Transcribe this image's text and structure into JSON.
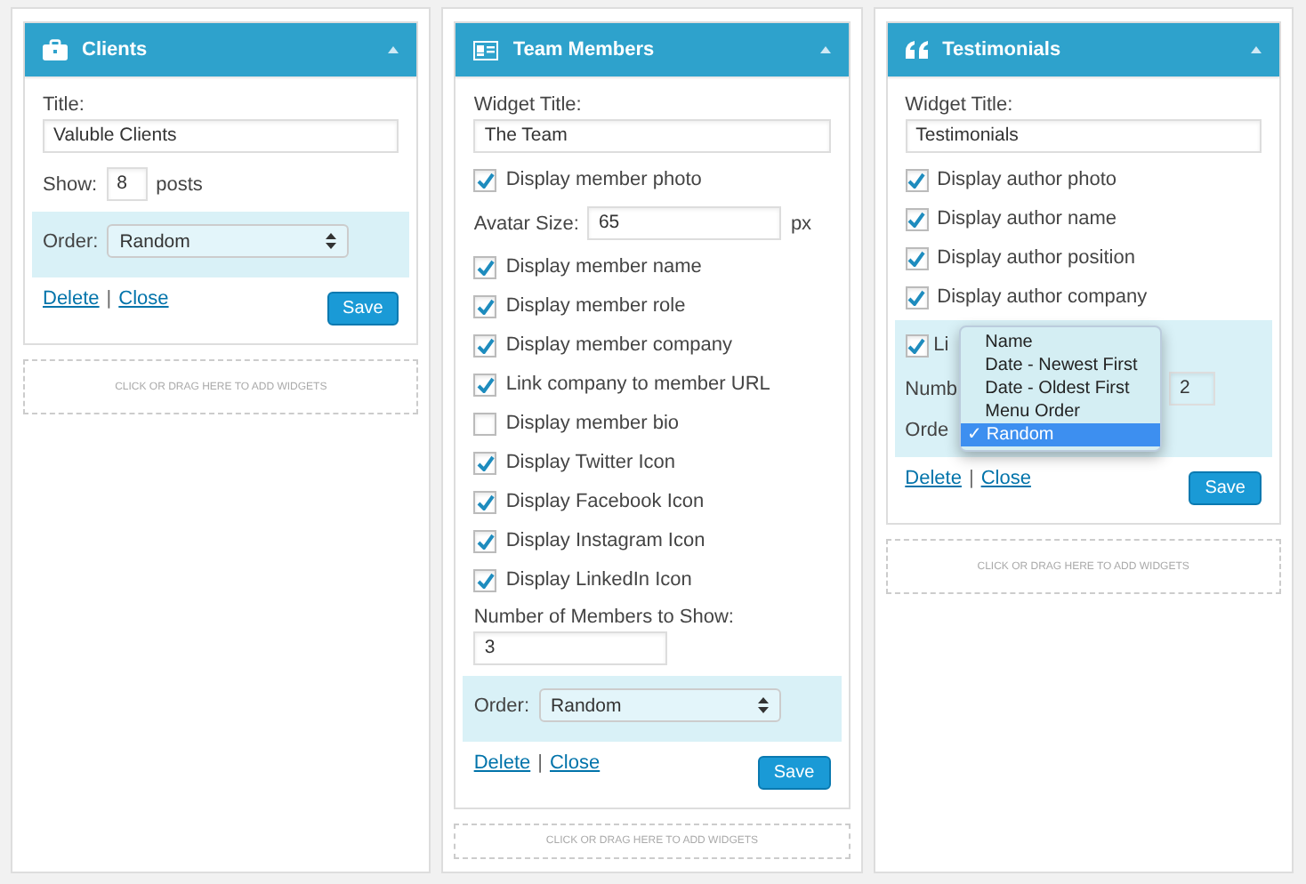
{
  "columns": [
    {
      "widget": {
        "title": "Clients",
        "fields": [
          {
            "kind": "label",
            "text": "Title:"
          },
          {
            "kind": "input",
            "value": "Valuble Clients"
          },
          {
            "kind": "count",
            "label": "Show:",
            "value": "8",
            "suffix": "posts"
          },
          {
            "kind": "group",
            "fields": [
              {
                "kind": "select",
                "label": "Order:",
                "value": "Random"
              }
            ]
          }
        ],
        "delete": "Delete",
        "separator": "|",
        "close": "Close",
        "save": "Save"
      },
      "dropzone": "CLICK OR DRAG HERE TO ADD WIDGETS"
    },
    {
      "widget": {
        "title": "Team Members",
        "fields": [
          {
            "kind": "label",
            "text": "Widget Title:"
          },
          {
            "kind": "input",
            "value": "The Team"
          },
          {
            "kind": "checkbox",
            "label": "Display member photo",
            "checked": true
          },
          {
            "kind": "size",
            "label": "Avatar Size:",
            "value": "65",
            "suffix": "px"
          },
          {
            "kind": "checkbox",
            "label": "Display member name",
            "checked": true
          },
          {
            "kind": "checkbox",
            "label": "Display member role",
            "checked": true
          },
          {
            "kind": "checkbox",
            "label": "Display member company",
            "checked": true
          },
          {
            "kind": "checkbox",
            "label": "Link company to member URL",
            "checked": true
          },
          {
            "kind": "checkbox",
            "label": "Display member bio",
            "checked": false
          },
          {
            "kind": "checkbox",
            "label": "Display Twitter Icon",
            "checked": true
          },
          {
            "kind": "checkbox",
            "label": "Display Facebook Icon",
            "checked": true
          },
          {
            "kind": "checkbox",
            "label": "Display Instagram Icon",
            "checked": true
          },
          {
            "kind": "checkbox",
            "label": "Display LinkedIn Icon",
            "checked": true
          },
          {
            "kind": "label",
            "text": "Number of Members to Show:"
          },
          {
            "kind": "short-input",
            "value": "3"
          },
          {
            "kind": "group",
            "fields": [
              {
                "kind": "select",
                "label": "Order:",
                "value": "Random"
              }
            ]
          }
        ],
        "delete": "Delete",
        "separator": "|",
        "close": "Close",
        "save": "Save"
      },
      "dropzone": "CLICK OR DRAG HERE TO ADD WIDGETS"
    },
    {
      "widget": {
        "title": "Testimonials",
        "fields": [
          {
            "kind": "label",
            "text": "Widget Title:"
          },
          {
            "kind": "input",
            "value": "Testimonials"
          },
          {
            "kind": "checkbox",
            "label": "Display author photo",
            "checked": true
          },
          {
            "kind": "checkbox",
            "label": "Display author name",
            "checked": true
          },
          {
            "kind": "checkbox",
            "label": "Display author position",
            "checked": true
          },
          {
            "kind": "checkbox",
            "label": "Display author company",
            "checked": true
          },
          {
            "kind": "group",
            "fields": [
              {
                "kind": "checkbox",
                "label": "Li",
                "checked": true
              },
              {
                "kind": "count",
                "label": "Numb",
                "value": "2"
              },
              {
                "kind": "label",
                "text": "Orde"
              }
            ],
            "menu": [
              {
                "label": "Name",
                "selected": false
              },
              {
                "label": "Date - Newest First",
                "selected": false
              },
              {
                "label": "Date - Oldest First",
                "selected": false
              },
              {
                "label": "Menu Order",
                "selected": false
              },
              {
                "label": "✓ Random",
                "selected": true
              }
            ]
          }
        ],
        "delete": "Delete",
        "separator": "|",
        "close": "Close",
        "save": "Save"
      },
      "dropzone": "CLICK OR DRAG HERE TO ADD WIDGETS"
    }
  ]
}
